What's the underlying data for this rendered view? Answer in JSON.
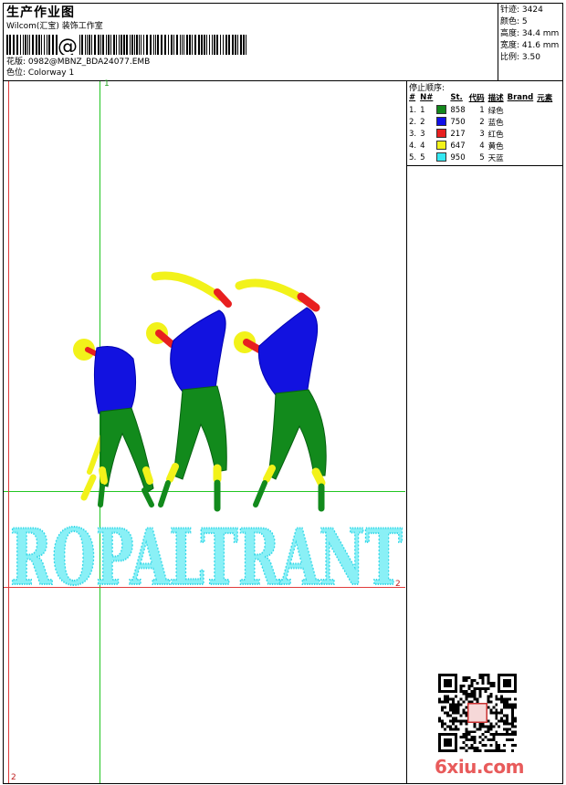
{
  "header": {
    "title": "生产作业图",
    "company": "Wilcom(汇宝) 装饰工作室",
    "design_label": "花版: 0982@MBNZ_BDA24077.EMB",
    "colorway_label": "色位: Colorway 1"
  },
  "stats": {
    "stitches": "针迹: 3424",
    "colors": "颜色: 5",
    "height": "高度: 34.4 mm",
    "width": "宽度: 41.6 mm",
    "scale": "比例: 3.50"
  },
  "sequence": {
    "title": "停止顺序:",
    "headers": [
      "#",
      "N#",
      "St.",
      "代码",
      "描述",
      "Brand",
      "元素"
    ],
    "rows": [
      {
        "num": "1.",
        "n": "1",
        "color": "#13871c",
        "st": "858",
        "code": "1",
        "desc": "绿色"
      },
      {
        "num": "2.",
        "n": "2",
        "color": "#1010e8",
        "st": "750",
        "code": "2",
        "desc": "蓝色"
      },
      {
        "num": "3.",
        "n": "3",
        "color": "#e82020",
        "st": "217",
        "code": "3",
        "desc": "红色"
      },
      {
        "num": "4.",
        "n": "4",
        "color": "#f2f21a",
        "st": "647",
        "code": "4",
        "desc": "黄色"
      },
      {
        "num": "5.",
        "n": "5",
        "color": "#35e8f2",
        "st": "950",
        "code": "5",
        "desc": "天蓝"
      }
    ]
  },
  "design": {
    "text": "ROPALTRANT",
    "guide_marks": [
      "1",
      "2",
      "2"
    ]
  },
  "watermark": "6xiu.com"
}
